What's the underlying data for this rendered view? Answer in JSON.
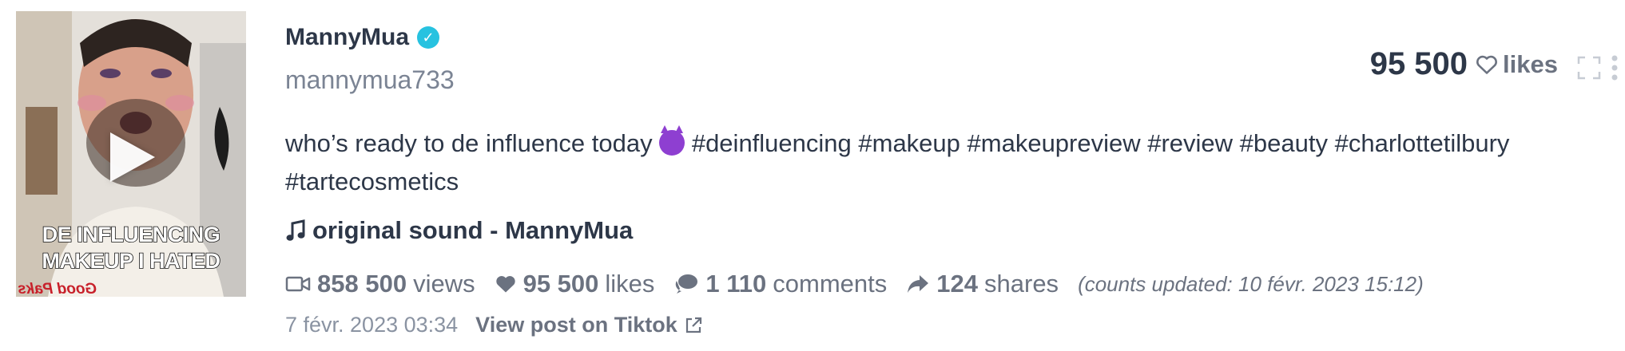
{
  "video": {
    "overlay_line1": "DE INFLUENCING",
    "overlay_line2": "MAKEUP I HATED",
    "brand_text": "Good Paks"
  },
  "author": {
    "name": "MannyMua",
    "verified_mark": "✓",
    "handle": "mannymua733"
  },
  "top_likes": {
    "count": "95 500",
    "label": "likes"
  },
  "caption": {
    "text_before_emoji": "who’s ready to de influence today",
    "hashtags": "#deinfluencing #makeup #makeupreview #review #beauty #charlottetilbury #tartecosmetics"
  },
  "sound": {
    "label": "original sound - MannyMua"
  },
  "stats": {
    "views": {
      "count": "858 500",
      "label": "views"
    },
    "likes": {
      "count": "95 500",
      "label": "likes"
    },
    "comments": {
      "count": "1 110",
      "label": "comments"
    },
    "shares": {
      "count": "124",
      "label": "shares"
    },
    "updated_prefix": "(counts updated:",
    "updated_date": "10 févr. 2023 15:12",
    "updated_suffix": ")"
  },
  "footer": {
    "date": "7 févr. 2023 03:34",
    "view_link": "View post on Tiktok"
  },
  "colors": {
    "text_dark": "#2d3748",
    "text_muted": "#6b7280",
    "verified": "#27c2e0",
    "emoji": "#8e3fd1"
  }
}
